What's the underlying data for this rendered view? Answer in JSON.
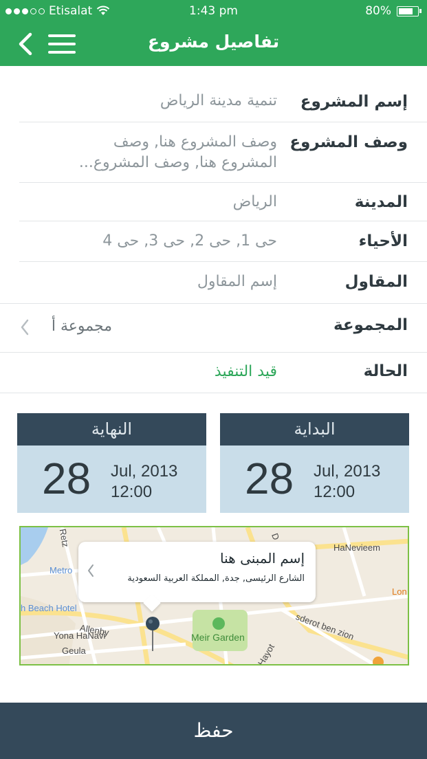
{
  "status_bar": {
    "carrier": "Etisalat",
    "time": "1:43 pm",
    "battery": "80%",
    "battery_level": 0.8
  },
  "header": {
    "title": "تفاصيل مشروع"
  },
  "details": [
    {
      "label": "إسم المشروع",
      "value": "تنمية مدينة الرياض"
    },
    {
      "label": "وصف المشروع",
      "value": "وصف المشروع هنا, وصف المشروع هنا, وصف المشروع..."
    },
    {
      "label": "المدينة",
      "value": "الرياض"
    },
    {
      "label": "الأحياء",
      "value": "حى 1, حى 2, حى 3, حى 4"
    },
    {
      "label": "المقاول",
      "value": "إسم المقاول"
    },
    {
      "label": "المجموعة",
      "value": "مجموعة أ"
    },
    {
      "label": "الحالة",
      "value": "قيد التنفيذ"
    }
  ],
  "dates": {
    "start": {
      "label": "البداية",
      "day": "28",
      "month_year": "Jul, 2013",
      "time": "12:00"
    },
    "end": {
      "label": "النهاية",
      "day": "28",
      "month_year": "Jul, 2013",
      "time": "12:00"
    }
  },
  "map": {
    "callout_title": "إسم المبنى هنا",
    "callout_subtitle": "الشارع الرئيسى, جدة, المملكة العربية السعودية",
    "labels": [
      "Retz",
      "Metro",
      "h Beach Hotel",
      "Allenby",
      "Yona HaNavi",
      "Geula",
      "Meir Garden",
      "HaNevieem",
      "sderot ben zion",
      "Hayot",
      "Lon",
      "D"
    ]
  },
  "save_label": "حفظ",
  "colors": {
    "primary_green": "#2ea75a",
    "dark_slate": "#34495a",
    "card_blue": "#c9dde9"
  }
}
